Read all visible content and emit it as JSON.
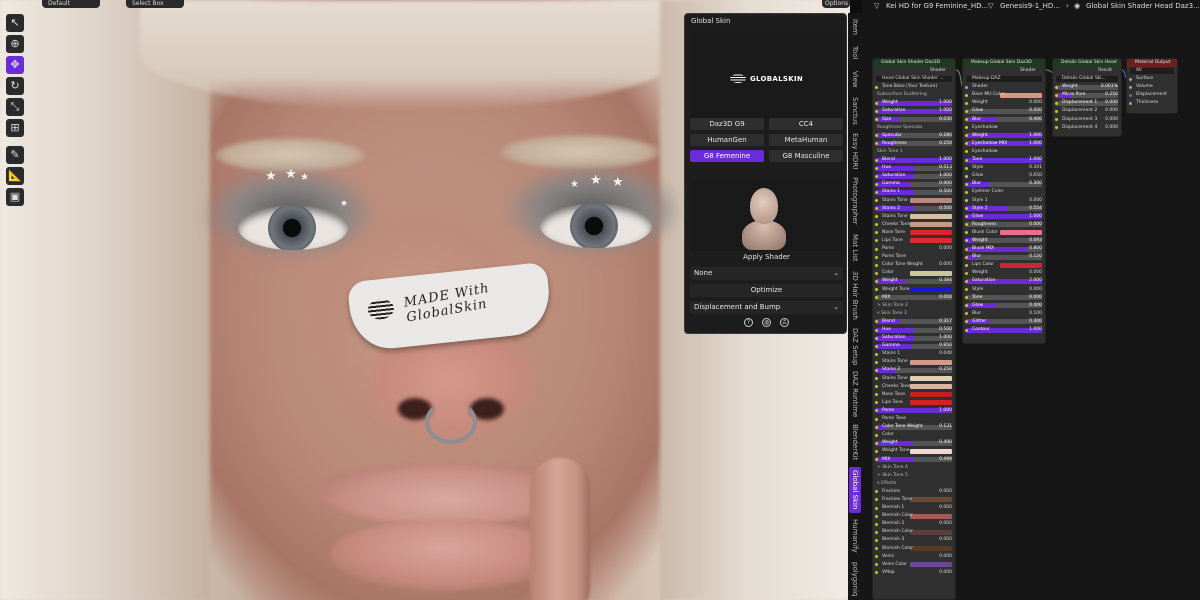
{
  "header": {
    "workspace": "Default",
    "select_mode": "Select Box",
    "options": "Options",
    "breadcrumb": [
      "Kei HD for G9 Feminine_HD...",
      "Genesis9-1_HD...",
      "Global Skin Shader Head Daz3..."
    ]
  },
  "viewport": {
    "patch_text": "MADE With GlobalSkin"
  },
  "toolbar": {
    "tools": [
      {
        "name": "cursor-icon",
        "glyph": "↖",
        "active": false
      },
      {
        "name": "3d-cursor-icon",
        "glyph": "⊕",
        "active": false
      },
      {
        "name": "move-icon",
        "glyph": "✥",
        "active": true
      },
      {
        "name": "rotate-icon",
        "glyph": "↻",
        "active": false
      },
      {
        "name": "scale-icon",
        "glyph": "⤡",
        "active": false
      },
      {
        "name": "transform-icon",
        "glyph": "⊞",
        "active": false
      },
      {
        "name": "annotate-icon",
        "glyph": "✎",
        "active": false
      },
      {
        "name": "measure-icon",
        "glyph": "📐",
        "active": false
      },
      {
        "name": "add-cube-icon",
        "glyph": "▣",
        "active": false
      }
    ]
  },
  "global_skin": {
    "title": "Global Skin",
    "logo_text": "GLOBALSKIN",
    "presets": [
      {
        "label": "Daz3D G9",
        "selected": false
      },
      {
        "label": "CC4",
        "selected": false
      },
      {
        "label": "HumanGen",
        "selected": false
      },
      {
        "label": "MetaHuman",
        "selected": false
      },
      {
        "label": "G8 Femenine",
        "selected": true
      },
      {
        "label": "G8 Masculine",
        "selected": false
      }
    ],
    "apply_shader": "Apply Shader",
    "dropdown_value": "None",
    "optimize": "Optimize",
    "displacement": "Displacement and Bump",
    "icons": [
      "help-icon",
      "globe-icon",
      "person-icon"
    ]
  },
  "sidebar_tabs": [
    {
      "label": "Item",
      "active": false
    },
    {
      "label": "Tool",
      "active": false
    },
    {
      "label": "View",
      "active": false
    },
    {
      "label": "Sanctus",
      "active": false
    },
    {
      "label": "Easy HDRI",
      "active": false
    },
    {
      "label": "Photographer",
      "active": false
    },
    {
      "label": "Mat List",
      "active": false
    },
    {
      "label": "3D Hair Brush",
      "active": false
    },
    {
      "label": "DAZ Setup",
      "active": false
    },
    {
      "label": "DAZ Runtime",
      "active": false
    },
    {
      "label": "BlenderKit",
      "active": false
    },
    {
      "label": "Global Skin",
      "active": true
    },
    {
      "label": "Humanify",
      "active": false
    },
    {
      "label": "polygoniq",
      "active": false
    }
  ],
  "nodes": [
    {
      "id": "shader",
      "title": "Global Skin Shader Daz3D",
      "type": "group",
      "rows": [
        {
          "k": "out",
          "label": "Shader"
        },
        {
          "k": "field",
          "label": "Head Global Skin Shader ..."
        },
        {
          "k": "text",
          "label": "Tone Base (Your Texture)",
          "dot": "y"
        },
        {
          "k": "sub",
          "label": "Subsurface Scattering"
        },
        {
          "k": "slider",
          "label": "Weight",
          "value": "1.000",
          "fill": 1.0
        },
        {
          "k": "slider",
          "label": "Saturation",
          "value": "1.000",
          "fill": 1.0
        },
        {
          "k": "slider",
          "label": "Size",
          "value": "0.030",
          "fill": 0.3
        },
        {
          "k": "sub",
          "label": "Roughness Specular"
        },
        {
          "k": "slider",
          "label": "Specular",
          "value": "0.280",
          "fill": 0.28
        },
        {
          "k": "slider",
          "label": "Roughness",
          "value": "0.250",
          "fill": 0.25
        },
        {
          "k": "sub",
          "label": "Skin Tone 1"
        },
        {
          "k": "slider",
          "label": "Blend",
          "value": "1.000",
          "fill": 1.0
        },
        {
          "k": "slider",
          "label": "Hue",
          "value": "0.513",
          "fill": 0.513
        },
        {
          "k": "slider",
          "label": "Saturation",
          "value": "1.000",
          "fill": 0.5
        },
        {
          "k": "slider",
          "label": "Gamma",
          "value": "0.900",
          "fill": 0.45
        },
        {
          "k": "slider",
          "label": "Stains 1",
          "value": "0.500",
          "fill": 0.5
        },
        {
          "k": "color",
          "label": "Stains Tone",
          "color": "#b58a7b"
        },
        {
          "k": "slider",
          "label": "Stains 2",
          "value": "0.500",
          "fill": 0.5
        },
        {
          "k": "color",
          "label": "Stains Tone",
          "color": "#d5c0a5"
        },
        {
          "k": "color",
          "label": "Cheeks Tone",
          "color": "#c89a86"
        },
        {
          "k": "color",
          "label": "Nose Tone",
          "color": "#d8262c"
        },
        {
          "k": "color",
          "label": "Lips Tone",
          "color": "#e02830"
        },
        {
          "k": "plain",
          "label": "Pores",
          "value": "0.000"
        },
        {
          "k": "text",
          "label": "Pores Tone",
          "dot": "y"
        },
        {
          "k": "plain",
          "label": "Color Tone Weight",
          "value": "0.000"
        },
        {
          "k": "color",
          "label": "Color",
          "color": "#c9c8a0"
        },
        {
          "k": "slider",
          "label": "Weight",
          "value": "0.384",
          "fill": 0.384
        },
        {
          "k": "color",
          "label": "Weight Tone",
          "color": "#1a1ad0"
        },
        {
          "k": "slider",
          "label": "MIX",
          "value": "0.000",
          "fill": 0.0
        },
        {
          "k": "sub",
          "label": "> Skin Tone 2"
        },
        {
          "k": "sub",
          "label": "v Skin Tone 3"
        },
        {
          "k": "slider",
          "label": "Blend",
          "value": "0.317",
          "fill": 0.317
        },
        {
          "k": "slider",
          "label": "Hue",
          "value": "0.500",
          "fill": 0.5
        },
        {
          "k": "slider",
          "label": "Saturation",
          "value": "1.000",
          "fill": 0.5
        },
        {
          "k": "slider",
          "label": "Gamma",
          "value": "0.950",
          "fill": 0.475
        },
        {
          "k": "plain",
          "label": "Stains 1",
          "value": "0.040"
        },
        {
          "k": "color",
          "label": "Stains Tone",
          "color": "#cf9b8a"
        },
        {
          "k": "slider",
          "label": "Stains 2",
          "value": "0.250",
          "fill": 0.25
        },
        {
          "k": "color",
          "label": "Stains Tone",
          "color": "#e0d0b5"
        },
        {
          "k": "color",
          "label": "Cheeks Tone",
          "color": "#d9b4a1"
        },
        {
          "k": "color",
          "label": "Nose Tone",
          "color": "#c81c24"
        },
        {
          "k": "color",
          "label": "Lips Tone",
          "color": "#d8202a"
        },
        {
          "k": "slider",
          "label": "Pores",
          "value": "1.000",
          "fill": 1.0
        },
        {
          "k": "text",
          "label": "Pores Tone",
          "dot": "y"
        },
        {
          "k": "slider",
          "label": "Color Tone Weight",
          "value": "0.131",
          "fill": 0.131
        },
        {
          "k": "text",
          "label": "Color",
          "dot": "y"
        },
        {
          "k": "slider",
          "label": "Weight",
          "value": "0.490",
          "fill": 0.49
        },
        {
          "k": "color",
          "label": "Weight Tone",
          "color": "#f2d6d2"
        },
        {
          "k": "slider",
          "label": "MIX",
          "value": "0.499",
          "fill": 0.499
        },
        {
          "k": "sub",
          "label": "> Skin Tone 4"
        },
        {
          "k": "sub",
          "label": "> Skin Tone 5"
        },
        {
          "k": "sub",
          "label": "v Effects"
        },
        {
          "k": "plain",
          "label": "Freckles",
          "value": "0.000"
        },
        {
          "k": "color",
          "label": "Freckles Tone",
          "color": "#6a4a35"
        },
        {
          "k": "plain",
          "label": "Blemish 1",
          "value": "0.000"
        },
        {
          "k": "color",
          "label": "Blemish Color",
          "color": "#a65a55"
        },
        {
          "k": "plain",
          "label": "Blemish 2",
          "value": "0.000"
        },
        {
          "k": "color",
          "label": "Blemish Color",
          "color": "#5a4038"
        },
        {
          "k": "plain",
          "label": "Blemish 3",
          "value": "0.000"
        },
        {
          "k": "color",
          "label": "Blemish Color",
          "color": "#5a3a25"
        },
        {
          "k": "plain",
          "label": "Veins",
          "value": "0.000"
        },
        {
          "k": "color",
          "label": "Veins Color",
          "color": "#6a4a90"
        },
        {
          "k": "plain",
          "label": "VMap",
          "value": "0.000"
        }
      ]
    },
    {
      "id": "makeup",
      "title": "Makeup Global Skin Daz3D",
      "type": "group",
      "rows": [
        {
          "k": "out",
          "label": "Shader"
        },
        {
          "k": "field",
          "label": "Makeup DAZ"
        },
        {
          "k": "text",
          "label": "Shader",
          "dot": "g"
        },
        {
          "k": "color",
          "label": "Base MU Color",
          "color": "#e8917a"
        },
        {
          "k": "plain",
          "label": "Weight",
          "value": "0.000"
        },
        {
          "k": "slider",
          "label": "Glow",
          "value": "0.000",
          "fill": 0.0
        },
        {
          "k": "slider",
          "label": "Blur",
          "value": "0.400",
          "fill": 0.4
        },
        {
          "k": "text",
          "label": "Eyeshadow",
          "dot": "y"
        },
        {
          "k": "slider",
          "label": "Weight",
          "value": "1.000",
          "fill": 1.0
        },
        {
          "k": "slider",
          "label": "Eyeshadow MIX",
          "value": "1.000",
          "fill": 1.0
        },
        {
          "k": "text",
          "label": "Eyeshadow",
          "dot": "y"
        },
        {
          "k": "slider",
          "label": "Tone",
          "value": "1.000",
          "fill": 1.0
        },
        {
          "k": "plain",
          "label": "Style",
          "value": "0.341"
        },
        {
          "k": "plain",
          "label": "Glow",
          "value": "0.650"
        },
        {
          "k": "slider",
          "label": "Blur",
          "value": "0.300",
          "fill": 0.3
        },
        {
          "k": "text",
          "label": "Eyeliner Color",
          "dot": "y"
        },
        {
          "k": "plain",
          "label": "Style 1",
          "value": "0.000"
        },
        {
          "k": "slider",
          "label": "Style 2",
          "value": "0.554",
          "fill": 0.554
        },
        {
          "k": "slider",
          "label": "Glow",
          "value": "1.000",
          "fill": 1.0
        },
        {
          "k": "slider",
          "label": "Roughness",
          "value": "0.000",
          "fill": 0.0
        },
        {
          "k": "color",
          "label": "Blush Color",
          "color": "#e8708a"
        },
        {
          "k": "slider",
          "label": "Weight",
          "value": "0.093",
          "fill": 0.093
        },
        {
          "k": "slider",
          "label": "Blush MIX",
          "value": "0.800",
          "fill": 0.8
        },
        {
          "k": "slider",
          "label": "Blur",
          "value": "0.150",
          "fill": 0.15
        },
        {
          "k": "color",
          "label": "Lips Color",
          "color": "#c8283a"
        },
        {
          "k": "plain",
          "label": "Weight",
          "value": "0.000"
        },
        {
          "k": "slider",
          "label": "Saturation",
          "value": "2.000",
          "fill": 1.0
        },
        {
          "k": "plain",
          "label": "Style",
          "value": "0.000"
        },
        {
          "k": "slider",
          "label": "Tone",
          "value": "0.000",
          "fill": 0.0
        },
        {
          "k": "slider",
          "label": "Glow",
          "value": "0.400",
          "fill": 0.4
        },
        {
          "k": "plain",
          "label": "Blur",
          "value": "0.100"
        },
        {
          "k": "slider",
          "label": "Glitter",
          "value": "0.300",
          "fill": 0.3
        },
        {
          "k": "slider",
          "label": "Contour",
          "value": "1.000",
          "fill": 1.0
        }
      ]
    },
    {
      "id": "details",
      "title": "Details Global Skin Head",
      "type": "group",
      "rows": [
        {
          "k": "out",
          "label": "Result"
        },
        {
          "k": "field",
          "label": "Details Global Ski..."
        },
        {
          "k": "slider",
          "label": "Weight",
          "value": "0.001%",
          "fill": 0.05
        },
        {
          "k": "slider",
          "label": "Micro Pore",
          "value": "0.250",
          "fill": 0.25
        },
        {
          "k": "slider",
          "label": "Displacement 1",
          "value": "0.000",
          "fill": 0.0
        },
        {
          "k": "plain",
          "label": "Displacement 2",
          "value": "0.000"
        },
        {
          "k": "plain",
          "label": "Displacement 3",
          "value": "0.000"
        },
        {
          "k": "plain",
          "label": "Displacement 4",
          "value": "0.000"
        }
      ]
    },
    {
      "id": "output",
      "title": "Material Output",
      "type": "mat",
      "rows": [
        {
          "k": "field",
          "label": "All"
        },
        {
          "k": "text",
          "label": "Surface",
          "dot": "g"
        },
        {
          "k": "text",
          "label": "Volume",
          "dot": "g"
        },
        {
          "k": "text",
          "label": "Displacement",
          "dot": "v"
        },
        {
          "k": "text",
          "label": "Thickness",
          "dot": "g"
        }
      ]
    }
  ]
}
